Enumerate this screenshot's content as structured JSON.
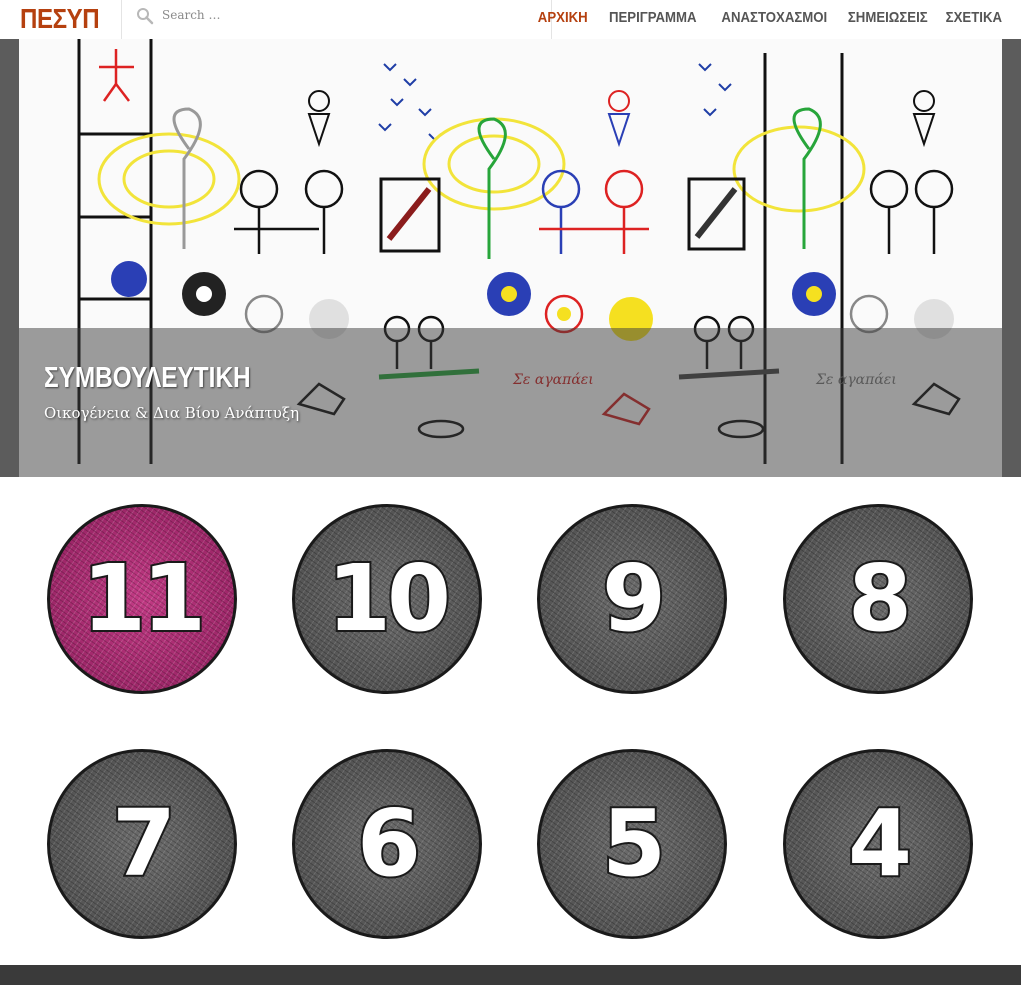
{
  "header": {
    "logo": "ΠΕΣΥΠ",
    "search_placeholder": "Search …",
    "nav": [
      {
        "label": "ΑΡΧΙΚΗ",
        "active": true
      },
      {
        "label": "ΠΕΡΙΓΡΑΜΜΑ",
        "active": false
      },
      {
        "label": "ΑΝΑΣΤΟΧΑΣΜΟΙ",
        "active": false
      },
      {
        "label": "ΣΗΜΕΙΩΣΕΙΣ",
        "active": false
      },
      {
        "label": "ΣΧΕΤΙΚΑ",
        "active": false
      }
    ]
  },
  "hero": {
    "title": "ΣΥΜΒΟΥΛΕΥΤΙΚΗ",
    "subtitle": "Οικογένεια & Δια Βίου Ανάπτυξη",
    "drawing_labels": [
      "Σε αγαπάει",
      "Σε αγαπάει"
    ]
  },
  "tiles": [
    {
      "number": "11",
      "color": "pink"
    },
    {
      "number": "10",
      "color": "gray"
    },
    {
      "number": "9",
      "color": "gray"
    },
    {
      "number": "8",
      "color": "gray"
    },
    {
      "number": "7",
      "color": "gray"
    },
    {
      "number": "6",
      "color": "gray"
    },
    {
      "number": "5",
      "color": "gray"
    },
    {
      "number": "4",
      "color": "gray"
    }
  ],
  "colors": {
    "accent": "#b5400f",
    "nav_text": "#555555",
    "tile_pink": "#a82a72",
    "tile_gray": "#5a5a5a",
    "footer": "#3a3a3a"
  }
}
